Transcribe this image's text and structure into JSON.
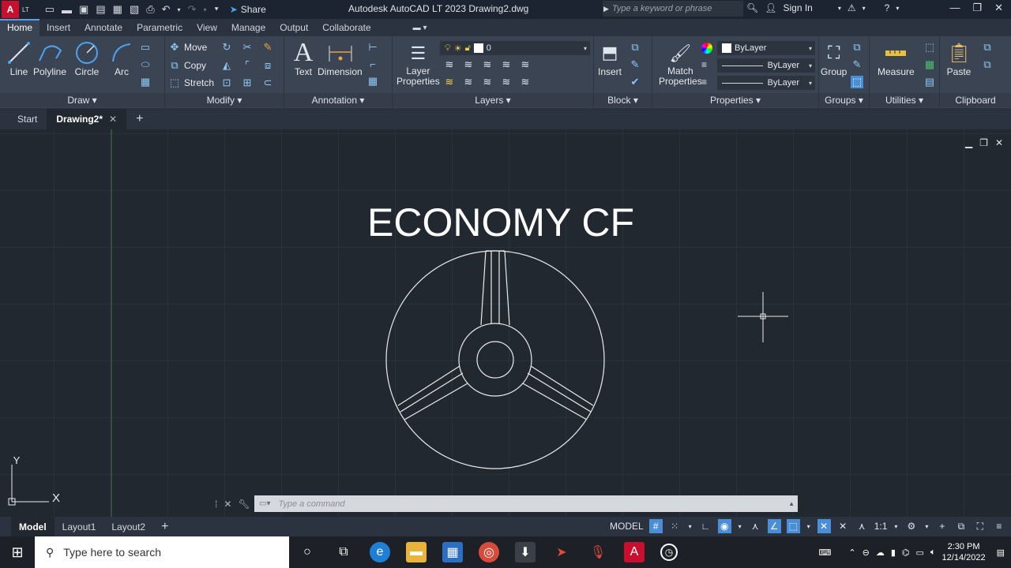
{
  "titlebar": {
    "app_logo": "A",
    "app_logo_sub": "LT",
    "share_label": "Share",
    "title": "Autodesk AutoCAD LT 2023   Drawing2.dwg",
    "search_placeholder": "Type a keyword or phrase",
    "sign_in": "Sign In"
  },
  "ribbon_tabs": [
    "Home",
    "Insert",
    "Annotate",
    "Parametric",
    "View",
    "Manage",
    "Output",
    "Collaborate"
  ],
  "draw": {
    "title": "Draw",
    "line": "Line",
    "polyline": "Polyline",
    "circle": "Circle",
    "arc": "Arc"
  },
  "modify": {
    "title": "Modify",
    "move": "Move",
    "copy": "Copy",
    "stretch": "Stretch"
  },
  "annotation": {
    "title": "Annotation",
    "text": "Text",
    "dimension": "Dimension"
  },
  "layers": {
    "title": "Layers",
    "layer_properties_1": "Layer",
    "layer_properties_2": "Properties",
    "current_layer": "0"
  },
  "block": {
    "title": "Block",
    "insert": "Insert"
  },
  "properties": {
    "title": "Properties",
    "match_1": "Match",
    "match_2": "Properties",
    "color": "ByLayer",
    "linetype": "ByLayer",
    "lineweight": "ByLayer"
  },
  "groups": {
    "title": "Groups",
    "group": "Group"
  },
  "utilities": {
    "title": "Utilities",
    "measure": "Measure"
  },
  "clipboard": {
    "title": "Clipboard",
    "paste": "Paste"
  },
  "doc_tabs": {
    "start": "Start",
    "drawing": "Drawing2*"
  },
  "drawing": {
    "heading": "ECONOMY CF",
    "ucs_y": "Y",
    "ucs_x": "X"
  },
  "command": {
    "placeholder": "Type  a  command"
  },
  "status": {
    "model_tab": "Model",
    "layout1": "Layout1",
    "layout2": "Layout2",
    "model_button": "MODEL",
    "scale": "1:1"
  },
  "taskbar": {
    "search_placeholder": "Type here to search",
    "time": "2:30 PM",
    "date": "12/14/2022"
  }
}
